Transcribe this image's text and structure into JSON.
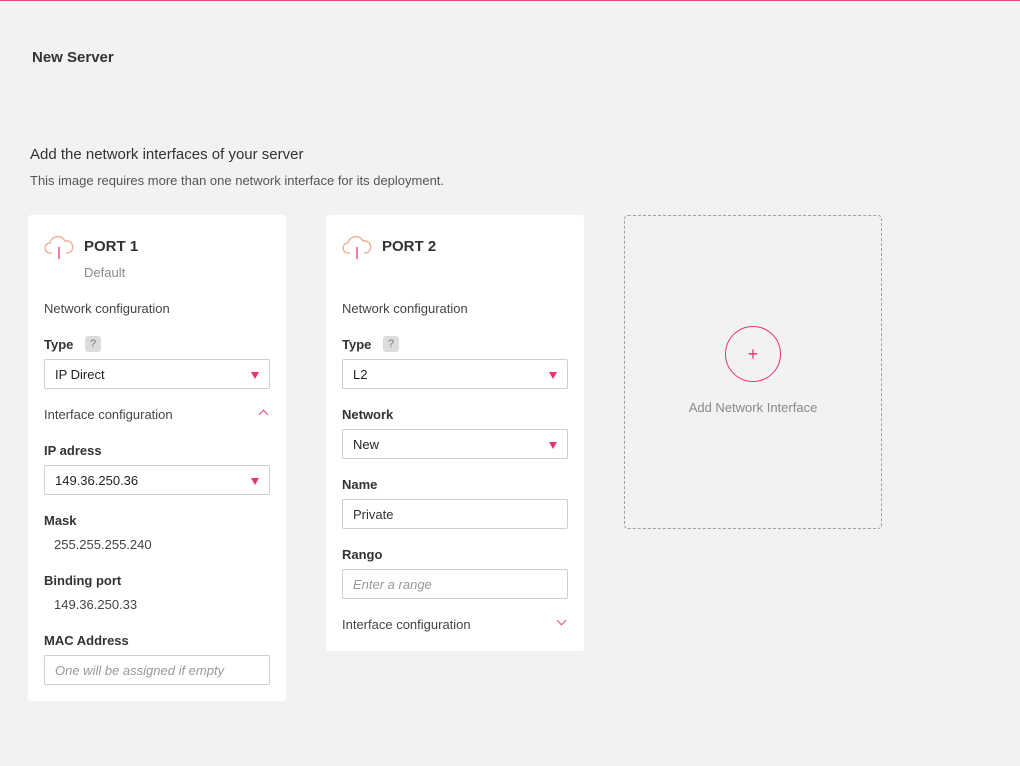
{
  "page": {
    "title": "New Server",
    "section_title": "Add the network interfaces of your server",
    "section_subtitle": "This image requires more than one network interface for its deployment."
  },
  "colors": {
    "accent": "#e8336d",
    "background": "#f2f2f2",
    "card": "#ffffff"
  },
  "port1": {
    "title": "PORT 1",
    "subtitle": "Default",
    "icon": "cloud-upload-icon",
    "network_configuration_label": "Network configuration",
    "type_label": "Type",
    "help_label": "?",
    "type_value": "IP Direct",
    "interface_configuration_label": "Interface configuration",
    "ip_label": "IP adress",
    "ip_value": "149.36.250.36",
    "mask_label": "Mask",
    "mask_value": "255.255.255.240",
    "binding_label": "Binding port",
    "binding_value": "149.36.250.33",
    "mac_label": "MAC Address",
    "mac_placeholder": "One will be assigned if empty"
  },
  "port2": {
    "title": "PORT 2",
    "icon": "cloud-upload-icon",
    "network_configuration_label": "Network configuration",
    "type_label": "Type",
    "help_label": "?",
    "type_value": "L2",
    "network_label": "Network",
    "network_value": "New",
    "name_label": "Name",
    "name_value": "Private",
    "range_label": "Rango",
    "range_placeholder": "Enter a range",
    "interface_configuration_label": "Interface configuration"
  },
  "add_interface": {
    "plus": "+",
    "label": "Add Network Interface"
  }
}
